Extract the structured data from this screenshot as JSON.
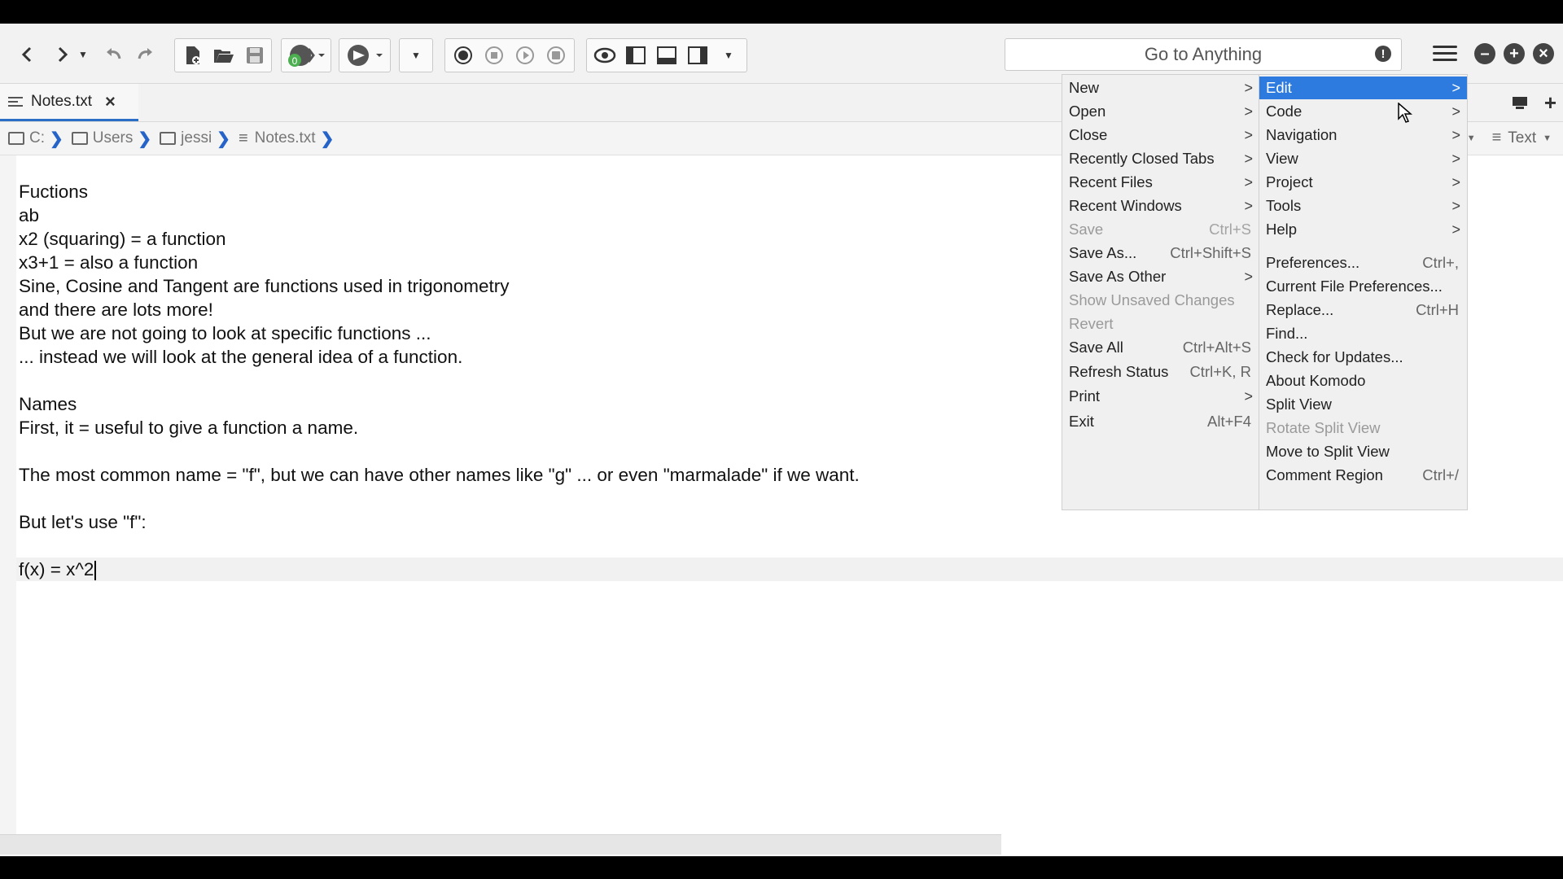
{
  "toolbar": {
    "icons": [
      "back-icon",
      "forward-icon",
      "history-dropdown-icon",
      "undo-icon",
      "redo-icon",
      "new-file-icon",
      "open-file-icon",
      "save-icon",
      "jump-icon",
      "browser-preview-icon",
      "dropdown-icon",
      "record-macro-icon",
      "stop-macro-icon",
      "play-macro-icon",
      "save-macro-icon",
      "focus-mode-icon",
      "left-pane-icon",
      "bottom-pane-icon",
      "right-pane-icon",
      "layout-dropdown-icon"
    ],
    "badge_count": "0"
  },
  "search": {
    "placeholder": "Go to Anything"
  },
  "tab": {
    "label": "Notes.txt"
  },
  "breadcrumb": {
    "items": [
      "C:",
      "Users",
      "jessi",
      "Notes.txt"
    ],
    "language": "Text"
  },
  "editor": {
    "lines": [
      "Fuctions",
      "ab",
      "x2 (squaring) = a function",
      "x3+1 = also a function",
      "Sine, Cosine and Tangent are functions used in trigonometry",
      "and there are lots more!",
      "But we are not going to look at specific functions ...",
      "... instead we will look at the general idea of a function.",
      "",
      "Names",
      "First, it = useful to give a function a name.",
      "",
      "The most common name = \"f\", but we can have other names like \"g\" ... or even \"marmalade\" if we want.",
      "",
      "But let's use \"f\":",
      "",
      "f(x) = x^2"
    ]
  },
  "file_menu": {
    "items": [
      {
        "label": "New",
        "shortcut": "",
        "submenu": true,
        "disabled": false
      },
      {
        "label": "Open",
        "shortcut": "",
        "submenu": true,
        "disabled": false
      },
      {
        "label": "Close",
        "shortcut": "",
        "submenu": true,
        "disabled": false
      },
      {
        "label": "Recently Closed Tabs",
        "shortcut": "",
        "submenu": true,
        "disabled": false
      },
      {
        "label": "Recent Files",
        "shortcut": "",
        "submenu": true,
        "disabled": false
      },
      {
        "label": "Recent Windows",
        "shortcut": "",
        "submenu": true,
        "disabled": false
      },
      {
        "label": "Save",
        "shortcut": "Ctrl+S",
        "submenu": false,
        "disabled": true
      },
      {
        "label": "Save As...",
        "shortcut": "Ctrl+Shift+S",
        "submenu": false,
        "disabled": false
      },
      {
        "label": "Save As Other",
        "shortcut": "",
        "submenu": true,
        "disabled": false
      },
      {
        "label": "Show Unsaved Changes",
        "shortcut": "",
        "submenu": false,
        "disabled": true
      },
      {
        "label": "Revert",
        "shortcut": "",
        "submenu": false,
        "disabled": true
      },
      {
        "label": "Save All",
        "shortcut": "Ctrl+Alt+S",
        "submenu": false,
        "disabled": false
      },
      {
        "label": "Refresh Status",
        "shortcut": "Ctrl+K, R",
        "submenu": false,
        "disabled": false
      },
      {
        "label": "Print",
        "shortcut": "",
        "submenu": true,
        "disabled": false
      },
      {
        "label": "Exit",
        "shortcut": "Alt+F4",
        "submenu": false,
        "disabled": false
      }
    ]
  },
  "main_menu": {
    "items": [
      {
        "label": "Edit",
        "shortcut": "",
        "submenu": true,
        "disabled": false,
        "highlighted": true
      },
      {
        "label": "Code",
        "shortcut": "",
        "submenu": true,
        "disabled": false
      },
      {
        "label": "Navigation",
        "shortcut": "",
        "submenu": true,
        "disabled": false
      },
      {
        "label": "View",
        "shortcut": "",
        "submenu": true,
        "disabled": false
      },
      {
        "label": "Project",
        "shortcut": "",
        "submenu": true,
        "disabled": false
      },
      {
        "label": "Tools",
        "shortcut": "",
        "submenu": true,
        "disabled": false
      },
      {
        "label": "Help",
        "shortcut": "",
        "submenu": true,
        "disabled": false
      },
      {
        "label": "Preferences...",
        "shortcut": "Ctrl+,",
        "submenu": false,
        "disabled": false
      },
      {
        "label": "Current File Preferences...",
        "shortcut": "",
        "submenu": false,
        "disabled": false
      },
      {
        "label": "Replace...",
        "shortcut": "Ctrl+H",
        "submenu": false,
        "disabled": false
      },
      {
        "label": "Find...",
        "shortcut": "",
        "submenu": false,
        "disabled": false
      },
      {
        "label": "Check for Updates...",
        "shortcut": "",
        "submenu": false,
        "disabled": false
      },
      {
        "label": "About Komodo",
        "shortcut": "",
        "submenu": false,
        "disabled": false
      },
      {
        "label": "Split View",
        "shortcut": "",
        "submenu": false,
        "disabled": false
      },
      {
        "label": "Rotate Split View",
        "shortcut": "",
        "submenu": false,
        "disabled": true
      },
      {
        "label": "Move to Split View",
        "shortcut": "",
        "submenu": false,
        "disabled": false
      },
      {
        "label": "Comment Region",
        "shortcut": "Ctrl+/",
        "submenu": false,
        "disabled": false
      }
    ]
  },
  "colors": {
    "accent": "#2e7be0",
    "breadcrumb_chevron": "#2563c9"
  }
}
